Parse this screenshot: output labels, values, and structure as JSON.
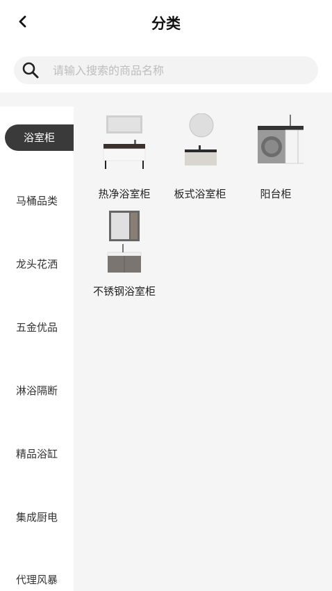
{
  "header": {
    "title": "分类"
  },
  "search": {
    "placeholder": "请输入搜索的商品名称"
  },
  "sidebar": {
    "items": [
      {
        "label": "浴室柜",
        "active": true
      },
      {
        "label": "马桶品类",
        "active": false
      },
      {
        "label": "龙头花洒",
        "active": false
      },
      {
        "label": "五金优品",
        "active": false
      },
      {
        "label": "淋浴隔断",
        "active": false
      },
      {
        "label": "精品浴缸",
        "active": false
      },
      {
        "label": "集成厨电",
        "active": false
      },
      {
        "label": "代理风暴",
        "active": false
      }
    ]
  },
  "products": [
    {
      "label": "热净浴室柜"
    },
    {
      "label": "板式浴室柜"
    },
    {
      "label": "阳台柜"
    },
    {
      "label": "不锈钢浴室柜"
    }
  ],
  "icons": {
    "back": "chevron-left-icon",
    "search": "search-icon"
  }
}
